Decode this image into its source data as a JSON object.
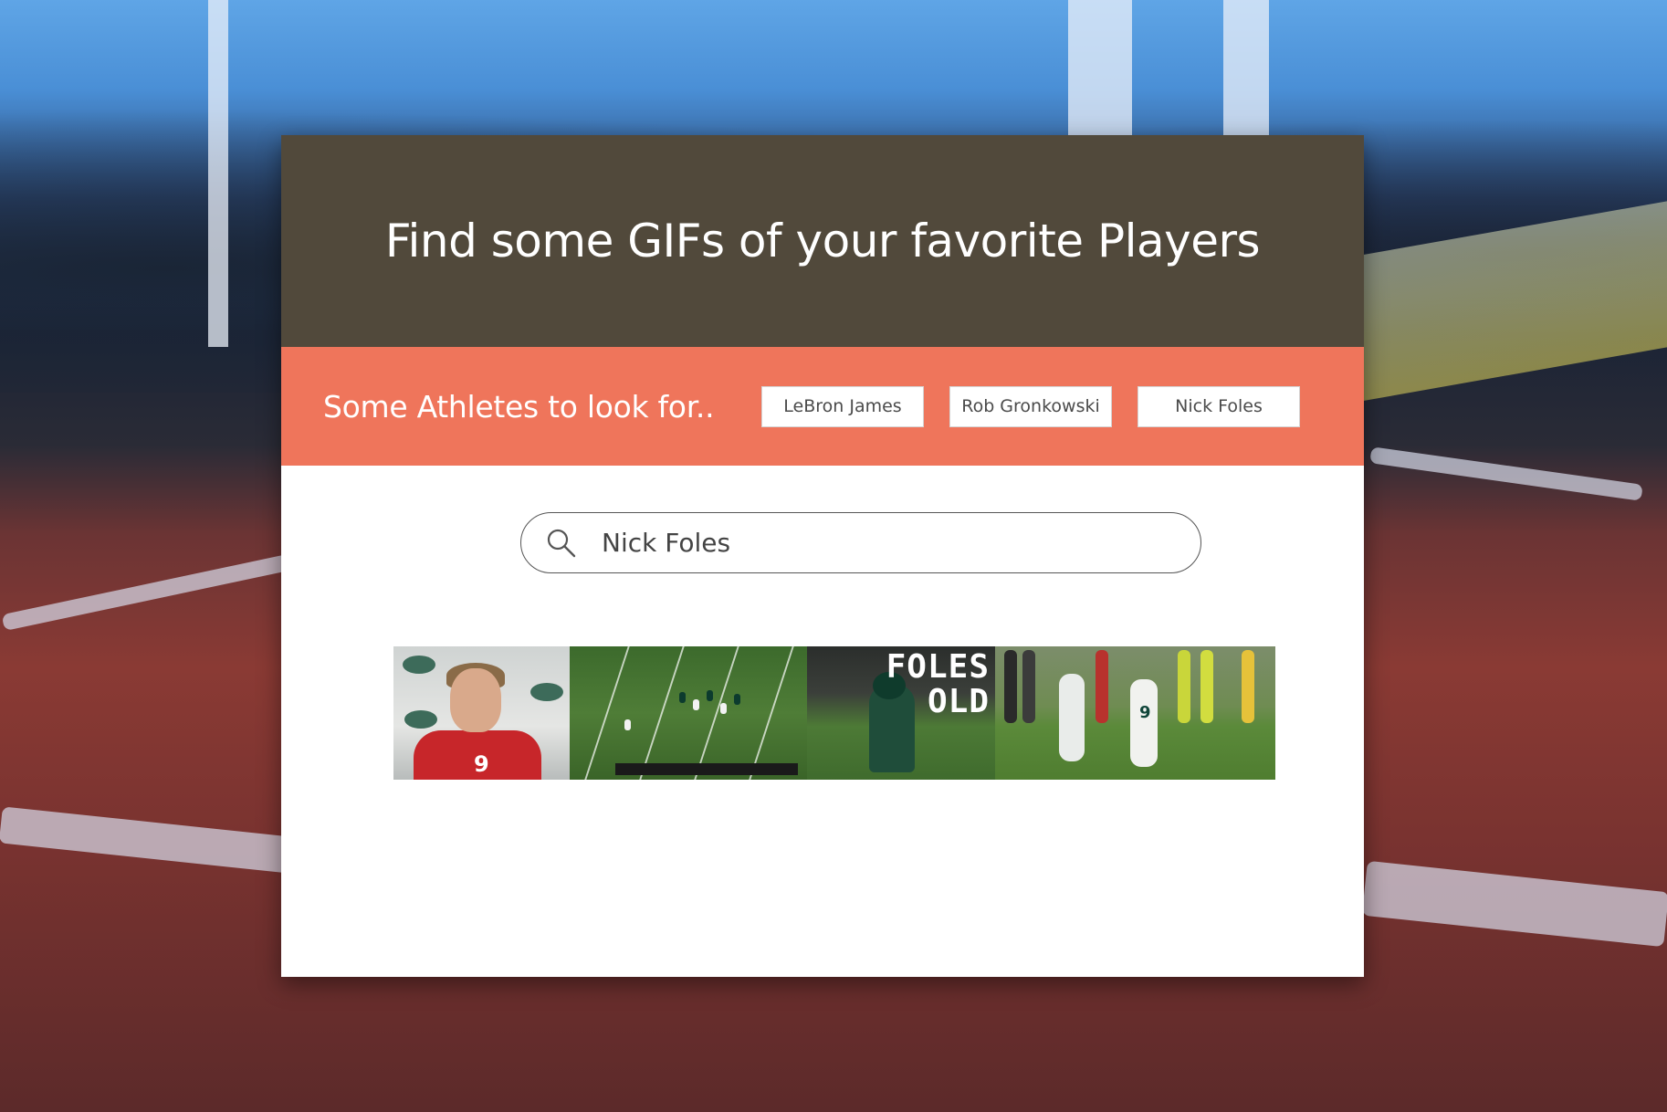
{
  "header": {
    "title": "Find some GIFs of your favorite Players"
  },
  "suggestions": {
    "label": "Some Athletes to look for..",
    "athletes": [
      "LeBron James",
      "Rob Gronkowski",
      "Nick Foles"
    ]
  },
  "search": {
    "value": "Nick Foles",
    "icon": "search-icon"
  },
  "gifs": [
    {
      "overlay_text": ""
    },
    {
      "overlay_text": ""
    },
    {
      "overlay_text": "FOLES\nOLD"
    },
    {
      "overlay_text": ""
    }
  ],
  "colors": {
    "header_bg": "#51493b",
    "suggest_bg": "#ef755b",
    "card_bg": "#ffffff"
  }
}
